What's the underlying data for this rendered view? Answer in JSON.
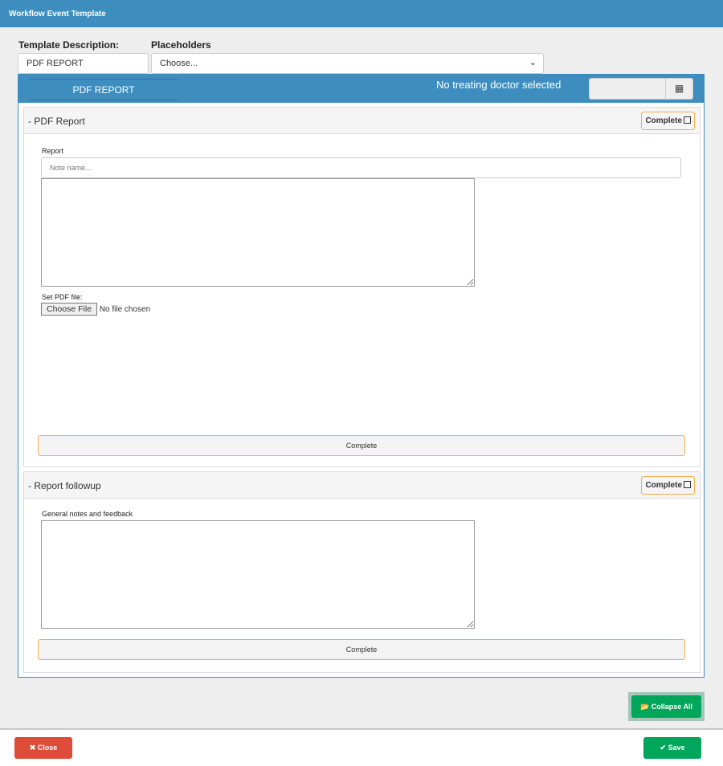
{
  "window": {
    "title": "Workflow Event Template"
  },
  "form": {
    "template_label": "Template Description:",
    "template_value": "PDF REPORT",
    "placeholders_label": "Placeholders",
    "placeholders_value": "Choose..."
  },
  "panel": {
    "tab": "PDF REPORT",
    "doctor_status": "No treating doctor selected",
    "calendar_icon": "calendar-icon"
  },
  "sections": [
    {
      "title": "- PDF Report",
      "complete_label": "Complete",
      "report_label": "Report",
      "note_placeholder": "Note name...",
      "file_label": "Set PDF file:",
      "choose_file": "Choose File",
      "no_file": "No file chosen",
      "complete_button": "Complete"
    },
    {
      "title": "- Report followup",
      "complete_label": "Complete",
      "notes_label": "General notes and feedback",
      "complete_button": "Complete"
    }
  ],
  "footer": {
    "collapse_all": "Collapse All",
    "close": "Close",
    "save": "Save"
  },
  "colors": {
    "brand": "#3d8ebf",
    "success": "#00a65a",
    "danger": "#dd4b39",
    "warning": "#f0ad4e"
  }
}
